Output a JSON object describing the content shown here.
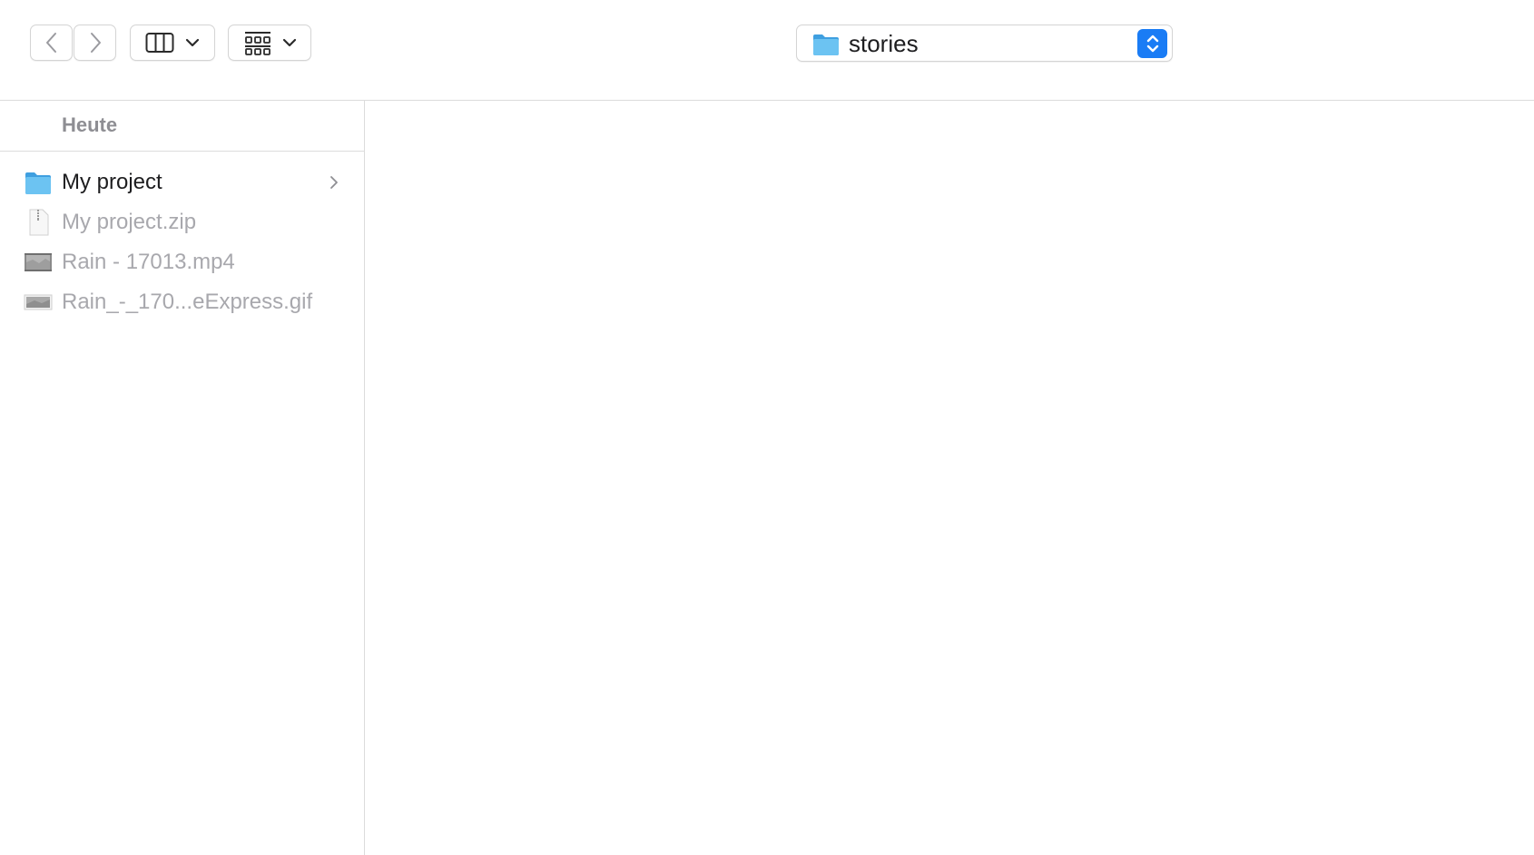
{
  "toolbar": {
    "back_icon": "chevron-left-icon",
    "forward_icon": "chevron-right-icon",
    "view_mode_icon": "column-view-icon",
    "group_icon": "grid-group-icon"
  },
  "location": {
    "label": "stories",
    "icon": "folder-icon"
  },
  "column": {
    "header": "Heute",
    "items": [
      {
        "label": "My project",
        "icon": "folder-icon",
        "enabled": true,
        "has_children": true
      },
      {
        "label": "My project.zip",
        "icon": "zip-file-icon",
        "enabled": false
      },
      {
        "label": "Rain - 17013.mp4",
        "icon": "video-file-icon",
        "enabled": false
      },
      {
        "label": "Rain_-_170...eExpress.gif",
        "icon": "image-file-icon",
        "enabled": false
      }
    ]
  },
  "colors": {
    "accent": "#1a7cf5",
    "folder": "#5ab7ef",
    "dim_text": "#a8a8ad"
  }
}
